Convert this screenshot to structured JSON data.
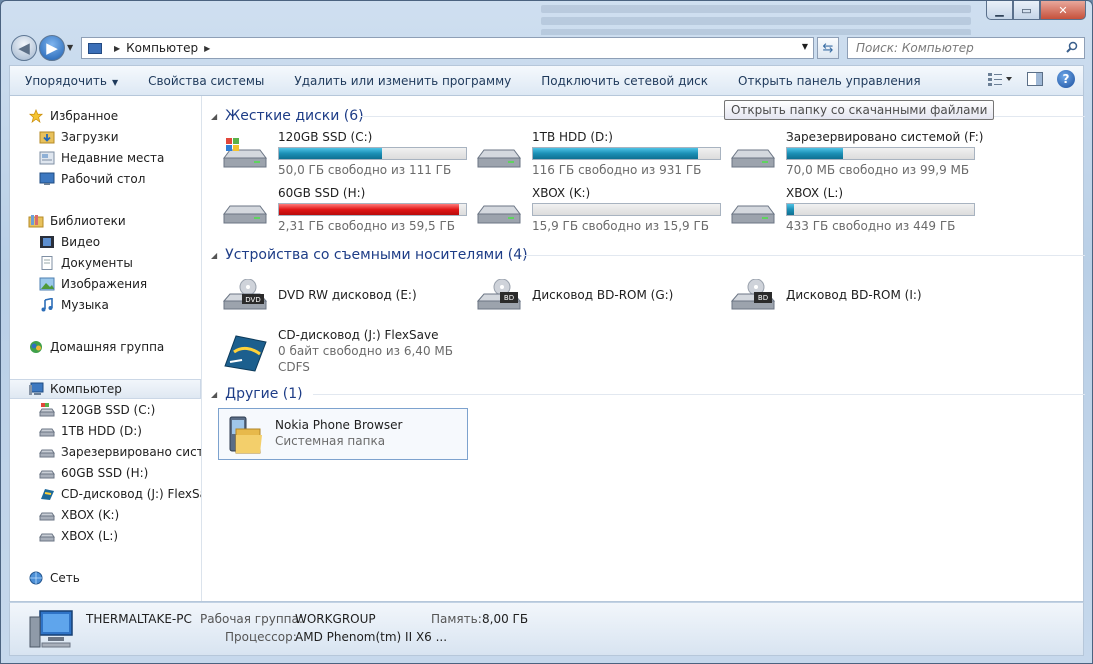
{
  "window": {
    "caption_buttons": [
      "minimize-icon",
      "maximize-icon",
      "close-icon"
    ]
  },
  "nav": {
    "back_glyph": "◀",
    "forward_glyph": "▶",
    "address": [
      "Компьютер"
    ],
    "search_placeholder": "Поиск: Компьютер"
  },
  "toolbar": {
    "organize": "Упорядочить",
    "system_properties": "Свойства системы",
    "uninstall": "Удалить или изменить программу",
    "map_drive": "Подключить сетевой диск",
    "control_panel": "Открыть панель управления"
  },
  "tooltip": "Открыть папку со скачанными файлами",
  "sidebar": {
    "favorites": "Избранное",
    "downloads": "Загрузки",
    "recent": "Недавние места",
    "desktop": "Рабочий стол",
    "libraries": "Библиотеки",
    "video": "Видео",
    "documents": "Документы",
    "pictures": "Изображения",
    "music": "Музыка",
    "homegroup": "Домашняя группа",
    "computer": "Компьютер",
    "drive_c": "120GB SSD (C:)",
    "drive_d": "1TB HDD (D:)",
    "drive_f": "Зарезервировано системой",
    "drive_h": "60GB SSD (H:)",
    "drive_j": "CD-дисковод (J:) FlexSave",
    "drive_k": "XBOX (K:)",
    "drive_l": "XBOX (L:)",
    "network": "Сеть"
  },
  "groups": {
    "hard_disks": "Жесткие диски (6)",
    "removable": "Устройства со съемными носителями (4)",
    "other": "Другие (1)"
  },
  "hard_disks": [
    {
      "name": "120GB SSD (C:)",
      "free": "50,0 ГБ свободно из 111 ГБ",
      "used_fraction": 0.55,
      "color": "#1b8fb5"
    },
    {
      "name": "1TB HDD (D:)",
      "free": "116 ГБ свободно из 931 ГБ",
      "used_fraction": 0.88,
      "color": "#1b8fb5"
    },
    {
      "name": "Зарезервировано системой (F:)",
      "free": "70,0 МБ свободно из 99,9 МБ",
      "used_fraction": 0.3,
      "color": "#1b8fb5"
    },
    {
      "name": "60GB SSD (H:)",
      "free": "2,31 ГБ свободно из 59,5 ГБ",
      "used_fraction": 0.96,
      "color": "#e01616"
    },
    {
      "name": "XBOX (K:)",
      "free": "15,9 ГБ свободно из 15,9 ГБ",
      "used_fraction": 0.0,
      "color": "#1b8fb5"
    },
    {
      "name": "XBOX (L:)",
      "free": "433 ГБ свободно из 449 ГБ",
      "used_fraction": 0.04,
      "color": "#1b8fb5"
    }
  ],
  "removable": [
    {
      "name": "DVD RW дисковод (E:)",
      "badge": "DVD"
    },
    {
      "name": "Дисковод BD-ROM (G:)",
      "badge": "BD"
    },
    {
      "name": "Дисковод BD-ROM (I:)",
      "badge": "BD"
    },
    {
      "name": "CD-дисковод (J:) FlexSave",
      "line2": "0 байт свободно из 6,40 МБ",
      "line3": "CDFS"
    }
  ],
  "other": {
    "name": "Nokia Phone Browser",
    "type": "Системная папка"
  },
  "details": {
    "pc_name": "THERMALTAKE-PC",
    "workgroup_label": "Рабочая группа:",
    "workgroup_value": "WORKGROUP",
    "memory_label": "Память:",
    "memory_value": "8,00 ГБ",
    "cpu_label": "Процессор:",
    "cpu_value": "AMD Phenom(tm) II X6 ..."
  }
}
